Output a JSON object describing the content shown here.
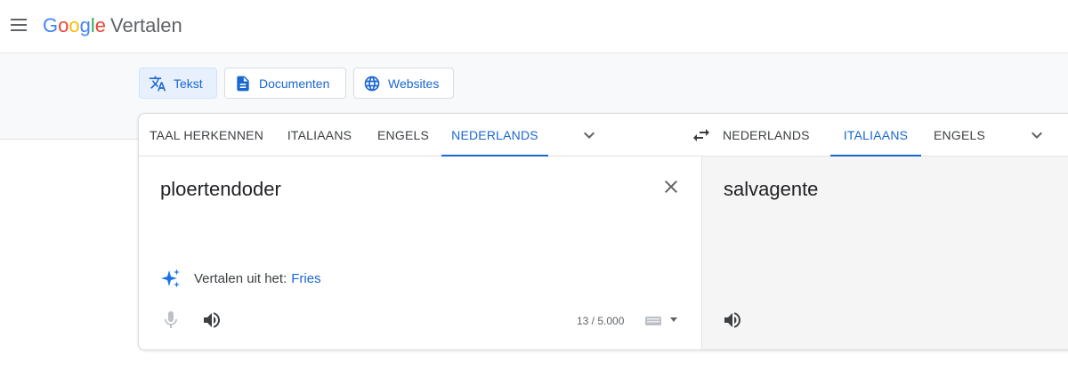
{
  "header": {
    "logo_letters": [
      "G",
      "o",
      "o",
      "g",
      "l",
      "e"
    ],
    "product_name": "Vertalen"
  },
  "modes": [
    {
      "label": "Tekst",
      "icon": "translate-icon",
      "active": true
    },
    {
      "label": "Documenten",
      "icon": "document-icon",
      "active": false
    },
    {
      "label": "Websites",
      "icon": "globe-icon",
      "active": false
    }
  ],
  "source_languages": [
    "TAAL HERKENNEN",
    "ITALIAANS",
    "ENGELS",
    "NEDERLANDS"
  ],
  "source_selected": "NEDERLANDS",
  "target_languages": [
    "NEDERLANDS",
    "ITALIAANS",
    "ENGELS"
  ],
  "target_selected": "ITALIAANS",
  "source": {
    "text": "ploertendoder",
    "suggestion_prefix": "Vertalen uit het:",
    "suggestion_language": "Fries",
    "char_count": "13 / 5.000"
  },
  "target": {
    "text": "salvagente"
  },
  "colors": {
    "accent": "#1967d2",
    "band": "#f8f9fa",
    "target_bg": "#f5f5f5"
  }
}
